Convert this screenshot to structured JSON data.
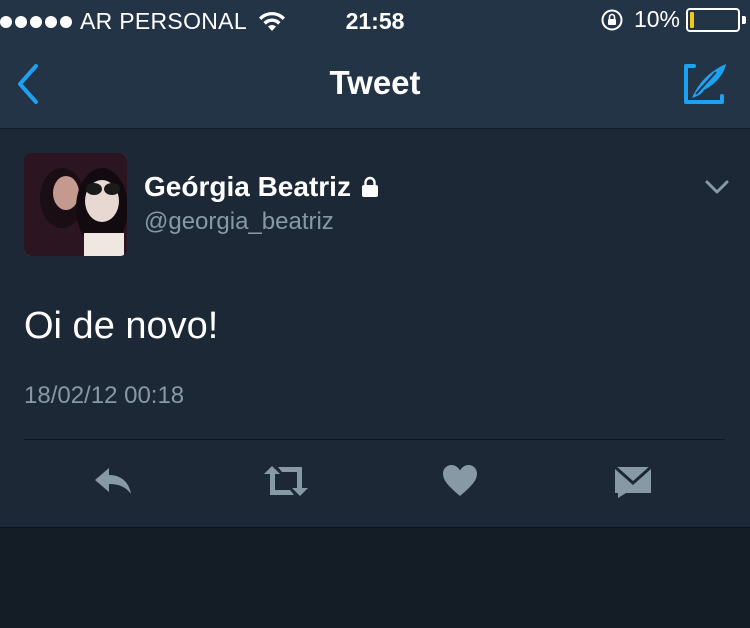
{
  "status_bar": {
    "carrier": "AR PERSONAL",
    "time": "21:58",
    "battery": "10%",
    "battery_level": 0.1
  },
  "nav": {
    "title": "Tweet"
  },
  "tweet": {
    "display_name": "Geórgia Beatriz",
    "handle": "@georgia_beatriz",
    "text": "Oi de novo!",
    "timestamp": "18/02/12 00:18"
  },
  "colors": {
    "accent": "#1da1f2",
    "secondary_text": "#8899a6",
    "battery_low": "#f5c518"
  }
}
